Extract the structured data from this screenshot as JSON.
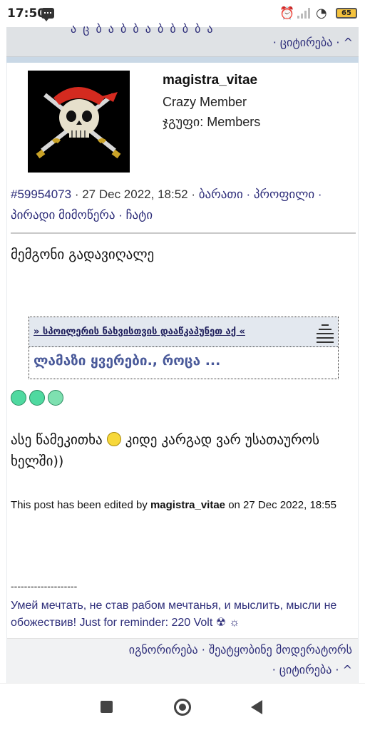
{
  "status_bar": {
    "time": "17:50",
    "battery": "65"
  },
  "previous_post": {
    "quote_link": "· ციტირება · ^"
  },
  "post": {
    "user": {
      "name": "magistra_vitae",
      "title": "Crazy Member",
      "group": "ჯგუფი: Members"
    },
    "meta": {
      "post_id": "#59954073",
      "date": "· 27 Dec 2022, 18:52 ·",
      "links": [
        "ბარათი",
        "პროფილი",
        "პირადი მიმოწერა",
        "ჩატი"
      ]
    },
    "body": "მემგონი გადავიღალე",
    "spoiler": {
      "title": "» სპოილერის ნახვისთვის დააწკაპუნეთ აქ «",
      "content": "ლამაზი ყვერები., როცა ..."
    },
    "quote_line_1": "ასე წამეკითხა",
    "quote_line_2": "კიდე კარგად ვარ უსათაუროს ხელში))",
    "edited": {
      "prefix": "This post has been edited by",
      "user": "magistra_vitae",
      "suffix": "on 27 Dec 2022, 18:55"
    },
    "signature": {
      "separator": "--------------------",
      "text": "Умей мечтать, не став рабом мечтанья, и мыслить, мысли не обожествив! Just for reminder: 220 Volt ☢ ☼"
    },
    "actions": {
      "ignore": "იგნორირება",
      "report": "შეატყობინე მოდერატორს",
      "quote": "ციტირება",
      "top": "^"
    }
  },
  "colors": {
    "link": "#2e2e7a",
    "strip": "#dfe2e5",
    "blue_line": "#c9d8e6",
    "spoiler_head": "#e3e8ef",
    "smile": "#4fd9a0"
  }
}
